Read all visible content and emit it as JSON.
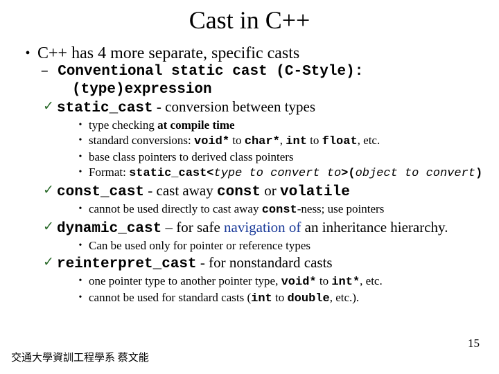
{
  "title": "Cast in C++",
  "main": "C++ has 4 more separate, specific casts",
  "conv": {
    "l1": "Conventional static cast (C-Style):",
    "l2": "(type)expression"
  },
  "sc": {
    "head_code": "static_cast",
    "head_rest": " - conversion between types",
    "s1a": "type checking ",
    "s1b": "at compile time",
    "s2a": "standard conversions: ",
    "s2b": "void*",
    "s2c": " to ",
    "s2d": "char*",
    "s2e": ", ",
    "s2f": "int",
    "s2g": " to ",
    "s2h": "float",
    "s2i": ", etc.",
    "s3": "base class pointers to derived class pointers",
    "s4a": "Format:   ",
    "s4b": "static_cast<",
    "s4c": "type to convert to",
    "s4d": ">(",
    "s4e": "object to convert",
    "s4f": ")"
  },
  "cc": {
    "head_code": "const_cast",
    "head_rest1": " - cast away ",
    "head_c": "const",
    "head_or": " or ",
    "head_v": "volatile",
    "s1a": "cannot be used directly to cast away ",
    "s1b": "const",
    "s1c": "-ness;  use pointers"
  },
  "dc": {
    "head_code": "dynamic_cast",
    "head_rest1": " – for safe ",
    "head_nav": "navigation of",
    "head_rest2": "  an inheritance hierarchy.",
    "s1": "Can be used only for pointer or reference types"
  },
  "rc": {
    "head_code": "reinterpret_cast",
    "head_rest": " - for nonstandard casts",
    "s1a": "one pointer type to another pointer type, ",
    "s1b": "void*",
    "s1c": " to ",
    "s1d": "int*",
    "s1e": ", etc.",
    "s2a": "cannot be used for standard casts (",
    "s2b": "int",
    "s2c": " to ",
    "s2d": "double",
    "s2e": ", etc.)."
  },
  "footer_left": "交通大學資訓工程學系 蔡文能",
  "footer_right": "15"
}
